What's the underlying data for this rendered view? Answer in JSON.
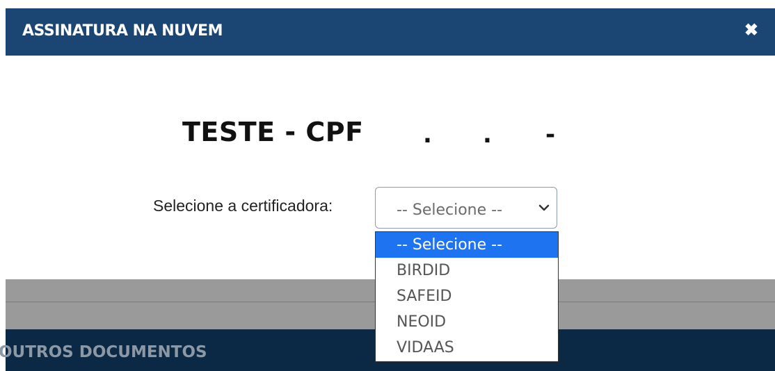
{
  "modal": {
    "title": "ASSINATURA NA NUVEM",
    "close_icon": "close-icon",
    "close_glyph": "✖"
  },
  "heading": {
    "text": "TESTE - CPF",
    "masked_dot1": ".",
    "masked_dot2": ".",
    "masked_dash": "-"
  },
  "certificadora": {
    "label": "Selecione a certificadora:",
    "selected_value": "-- Selecione --",
    "options": [
      "-- Selecione --",
      "BIRDID",
      "SAFEID",
      "NEOID",
      "VIDAAS"
    ],
    "highlighted_index": 0
  },
  "background_section": {
    "title": "OUTROS DOCUMENTOS"
  },
  "colors": {
    "header_bg": "#1b4674",
    "highlight": "#1e74f0",
    "dark_band": "#0b2845"
  }
}
